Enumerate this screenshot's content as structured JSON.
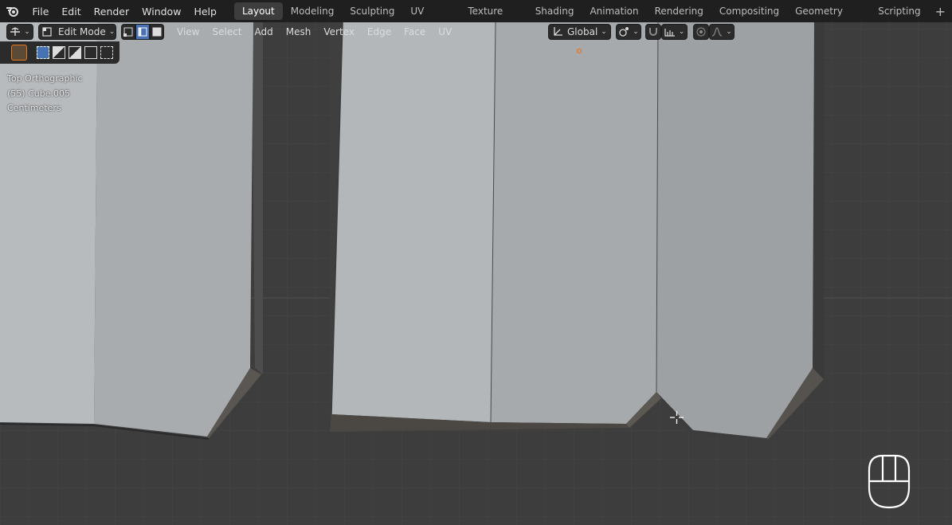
{
  "menu": {
    "items": [
      "File",
      "Edit",
      "Render",
      "Window",
      "Help"
    ]
  },
  "workspaces": {
    "tabs": [
      "Layout",
      "Modeling",
      "Sculpting",
      "UV Editing",
      "Texture Paint",
      "Shading",
      "Animation",
      "Rendering",
      "Compositing",
      "Geometry Nodes",
      "Scripting"
    ],
    "active": "Layout"
  },
  "header": {
    "mode": "Edit Mode",
    "view_menu": "View",
    "select_menu": "Select",
    "add_menu": "Add",
    "mesh_menu": "Mesh",
    "vertex_menu": "Vertex",
    "edge_menu": "Edge",
    "face_menu": "Face",
    "uv_menu": "UV",
    "orientation": "Global",
    "caret": "⌄"
  },
  "overlay": {
    "view_name": "Top Orthographic",
    "object": "(55) Cube.005",
    "units": "Centimeters"
  },
  "colors": {
    "topbar": "#1f1f1f",
    "viewport": "#3d3d3d",
    "grid": "#474747",
    "active_blue": "#4772b3",
    "vertex_orange": "#e8761c"
  },
  "icons": {
    "app": "blender-logo-icon",
    "add_workspace": "plus-icon",
    "mouse": "mouse-hint-icon",
    "cursor": "3d-cursor-icon"
  }
}
